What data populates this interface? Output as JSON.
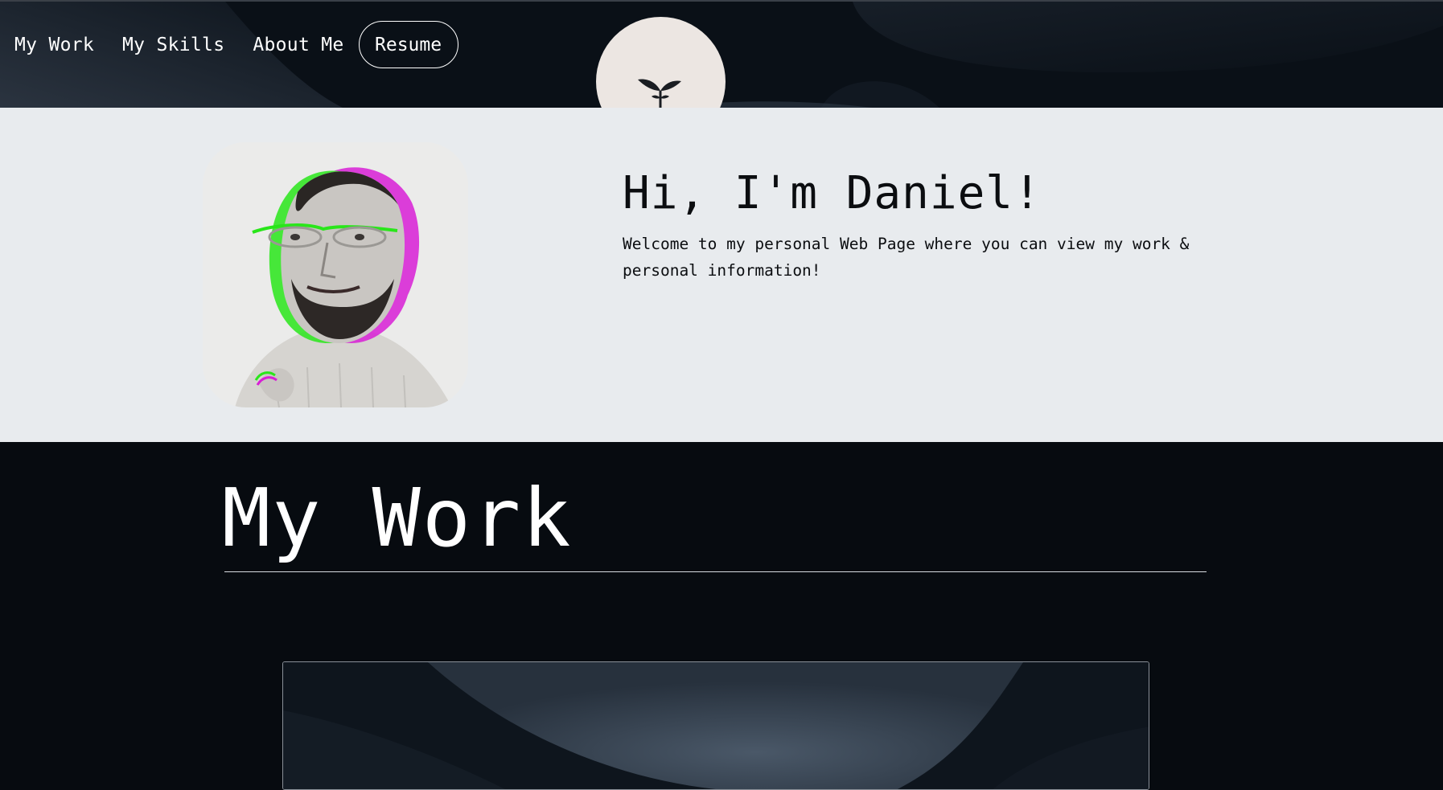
{
  "nav": {
    "items": [
      {
        "label": "My Work"
      },
      {
        "label": "My Skills"
      },
      {
        "label": "About Me"
      }
    ],
    "resume_label": "Resume"
  },
  "logo": {
    "icon": "sprout-icon"
  },
  "hero": {
    "title": "Hi, I'm Daniel!",
    "text": "Welcome to my personal Web Page where you can view my work & personal information!"
  },
  "work": {
    "title": "My Work"
  },
  "colors": {
    "header_bg": "#0a1017",
    "hero_bg": "#e8ebee",
    "page_bg": "#070b10",
    "logo_bg": "#ece6e2",
    "text_dark": "#0b0d10",
    "text_light": "#ffffff"
  }
}
